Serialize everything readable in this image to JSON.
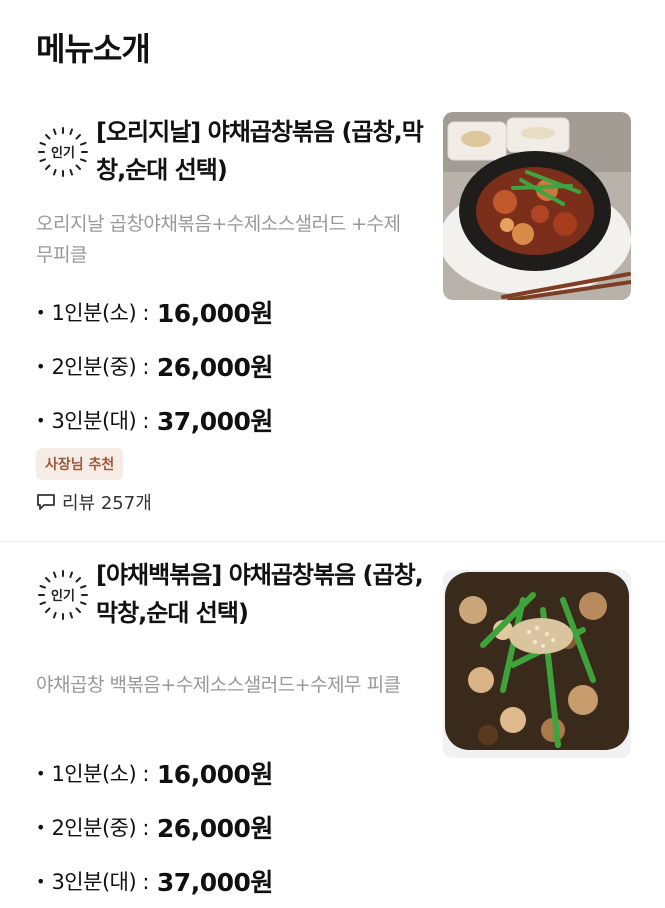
{
  "section_title": "메뉴소개",
  "items": [
    {
      "badge": "인기",
      "title": "[오리지날] 야채곱창볶음 (곱창,막창,순대 선택)",
      "description": "오리지날 곱창야채볶음+수제소스샐러드 +수제무피클",
      "prices": [
        {
          "size": "1인분(소) :",
          "price": "16,000원"
        },
        {
          "size": "2인분(중) :",
          "price": "26,000원"
        },
        {
          "size": "3인분(대) :",
          "price": "37,000원"
        }
      ],
      "tag": "사장님 추천",
      "reviews": "리뷰 257개"
    },
    {
      "badge": "인기",
      "title": "[야채백볶음] 야채곱창볶음 (곱창,막창,순대 선택)",
      "description": "야채곱창 백볶음+수제소스샐러드+수제무 피클",
      "prices": [
        {
          "size": "1인분(소) :",
          "price": "16,000원"
        },
        {
          "size": "2인분(중) :",
          "price": "26,000원"
        },
        {
          "size": "3인분(대) :",
          "price": "37,000원"
        }
      ]
    }
  ]
}
